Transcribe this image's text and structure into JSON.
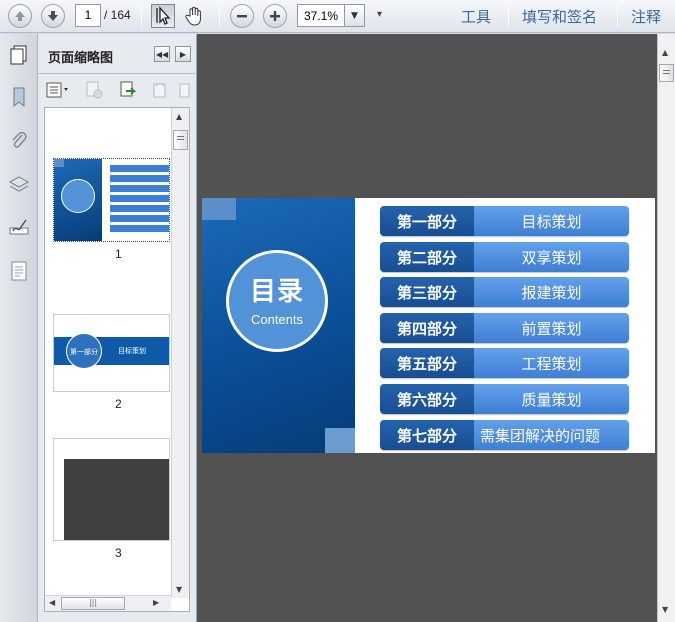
{
  "toolbar": {
    "current_page": "1",
    "total_pages": "/ 164",
    "zoom": "37.1%",
    "menus": [
      "工具",
      "填写和签名",
      "注释"
    ]
  },
  "panel": {
    "title": "页面缩略图",
    "thumbnails": [
      {
        "number": "1"
      },
      {
        "number": "2",
        "section_label": "第一部分",
        "section_title": "目标策划"
      },
      {
        "number": "3"
      }
    ]
  },
  "slide": {
    "title": "目录",
    "subtitle": "Contents",
    "rows": [
      {
        "part": "第一部分",
        "title": "目标策划"
      },
      {
        "part": "第二部分",
        "title": "双享策划"
      },
      {
        "part": "第三部分",
        "title": "报建策划"
      },
      {
        "part": "第四部分",
        "title": "前置策划"
      },
      {
        "part": "第五部分",
        "title": "工程策划"
      },
      {
        "part": "第六部分",
        "title": "质量策划"
      },
      {
        "part": "第七部分",
        "title": "需集团解决的问题"
      }
    ]
  },
  "icons": {
    "prev_page": "arrow-up-icon",
    "next_page": "arrow-down-icon",
    "select_tool": "cursor-icon",
    "hand_tool": "hand-icon",
    "zoom_out": "minus-icon",
    "zoom_in": "plus-icon",
    "page_thumbnails": "pages-icon",
    "bookmarks": "bookmark-icon",
    "attachments": "paperclip-icon",
    "layers": "layers-icon",
    "signatures": "signature-icon",
    "content": "content-icon"
  },
  "colors": {
    "slide_dark_blue": "#0a4f97",
    "slide_row_blue": "#4a8be0",
    "menu_link": "#3c6a9a",
    "doc_background": "#525252"
  }
}
